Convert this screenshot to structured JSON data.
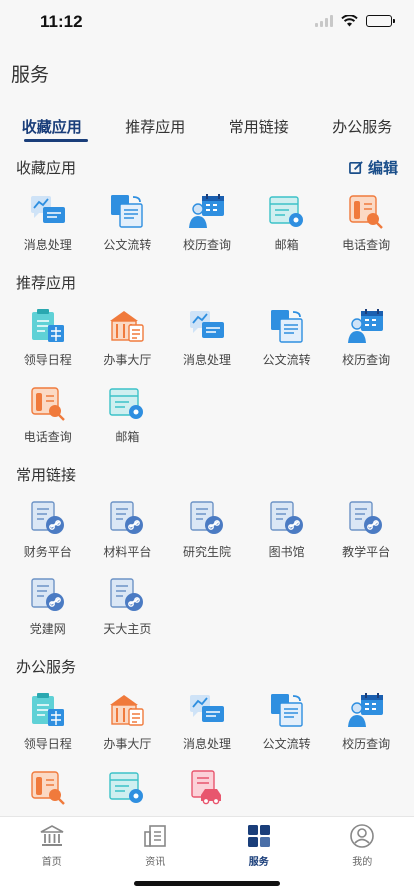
{
  "status_bar": {
    "time": "11:12"
  },
  "page_title": "服务",
  "tabs": [
    {
      "label": "收藏应用",
      "active": true
    },
    {
      "label": "推荐应用",
      "active": false
    },
    {
      "label": "常用链接",
      "active": false
    },
    {
      "label": "办公服务",
      "active": false
    }
  ],
  "sections": [
    {
      "title": "收藏应用",
      "action": "编辑",
      "items": [
        {
          "label": "消息处理",
          "icon": "message-icon"
        },
        {
          "label": "公文流转",
          "icon": "document-flow-icon"
        },
        {
          "label": "校历查询",
          "icon": "calendar-person-icon"
        },
        {
          "label": "邮箱",
          "icon": "mailbox-icon"
        },
        {
          "label": "电话查询",
          "icon": "phone-icon"
        }
      ]
    },
    {
      "title": "推荐应用",
      "items": [
        {
          "label": "领导日程",
          "icon": "schedule-icon"
        },
        {
          "label": "办事大厅",
          "icon": "service-hall-icon"
        },
        {
          "label": "消息处理",
          "icon": "message-icon"
        },
        {
          "label": "公文流转",
          "icon": "document-flow-icon"
        },
        {
          "label": "校历查询",
          "icon": "calendar-person-icon"
        },
        {
          "label": "电话查询",
          "icon": "phone-icon"
        },
        {
          "label": "邮箱",
          "icon": "mailbox-icon"
        }
      ]
    },
    {
      "title": "常用链接",
      "items": [
        {
          "label": "财务平台",
          "icon": "link-doc-icon"
        },
        {
          "label": "材料平台",
          "icon": "link-doc-icon"
        },
        {
          "label": "研究生院",
          "icon": "link-doc-icon"
        },
        {
          "label": "图书馆",
          "icon": "link-doc-icon"
        },
        {
          "label": "教学平台",
          "icon": "link-doc-icon"
        },
        {
          "label": "党建网",
          "icon": "link-doc-icon"
        },
        {
          "label": "天大主页",
          "icon": "link-doc-icon"
        }
      ]
    },
    {
      "title": "办公服务",
      "items": [
        {
          "label": "领导日程",
          "icon": "schedule-icon"
        },
        {
          "label": "办事大厅",
          "icon": "service-hall-icon"
        },
        {
          "label": "消息处理",
          "icon": "message-icon"
        },
        {
          "label": "公文流转",
          "icon": "document-flow-icon"
        },
        {
          "label": "校历查询",
          "icon": "calendar-person-icon"
        },
        {
          "label": "",
          "icon": "phone-icon"
        },
        {
          "label": "",
          "icon": "mailbox-icon"
        },
        {
          "label": "",
          "icon": "vehicle-icon"
        }
      ]
    }
  ],
  "tabbar": [
    {
      "label": "首页",
      "icon": "home-icon",
      "active": false
    },
    {
      "label": "资讯",
      "icon": "news-icon",
      "active": false
    },
    {
      "label": "服务",
      "icon": "service-grid-icon",
      "active": true
    },
    {
      "label": "我的",
      "icon": "profile-icon",
      "active": false
    }
  ],
  "colors": {
    "accent": "#1a3e7a",
    "blue": "#2f8fe0",
    "orange": "#f07a3c",
    "teal": "#3cc2c8",
    "pink": "#e8566e"
  }
}
